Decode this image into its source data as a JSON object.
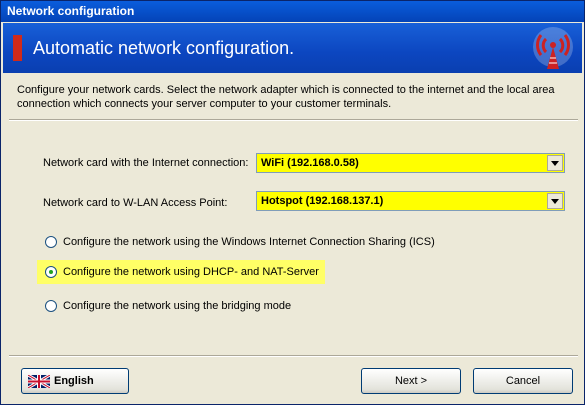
{
  "window": {
    "title": "Network configuration"
  },
  "banner": {
    "title": "Automatic network configuration."
  },
  "description": "Configure your network cards. Select the network adapter which is connected to the internet and the local area connection which connects your server computer to your customer terminals.",
  "internet_card": {
    "label": "Network card with the Internet connection:",
    "value": "WiFi (192.168.0.58)"
  },
  "wlan_card": {
    "label": "Network card to W-LAN Access Point:",
    "value": "Hotspot (192.168.137.1)"
  },
  "options": [
    {
      "label": "Configure the network using the Windows Internet Connection Sharing (ICS)",
      "selected": false
    },
    {
      "label": "Configure the network using DHCP- and NAT-Server",
      "selected": true
    },
    {
      "label": "Configure the network using the bridging mode",
      "selected": false
    }
  ],
  "buttons": {
    "language": "English",
    "next": "Next >",
    "cancel": "Cancel"
  },
  "colors": {
    "highlight": "#ffff00",
    "banner": "#0c46c0",
    "accent_red": "#d02a1a"
  },
  "icons": {
    "banner": "antenna-icon",
    "language": "uk-flag-icon"
  }
}
